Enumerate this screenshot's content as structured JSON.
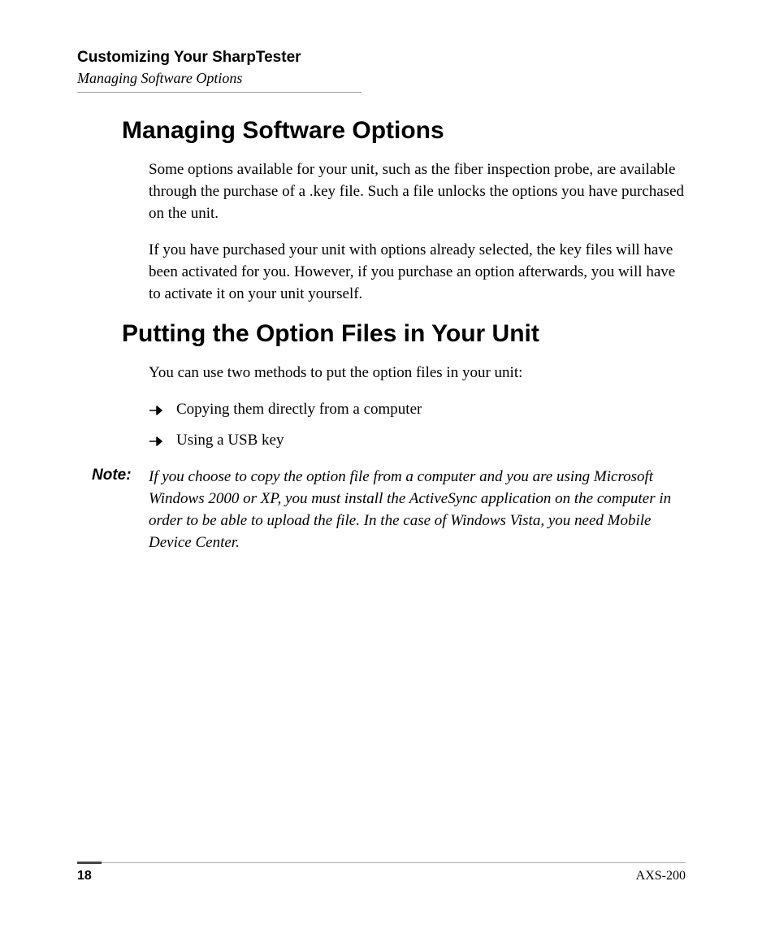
{
  "header": {
    "chapter": "Customizing Your SharpTester",
    "section": "Managing Software Options"
  },
  "sections": {
    "h1": "Managing Software Options",
    "p1": "Some options available for your unit, such as the fiber inspection probe, are available through the purchase of a .key file. Such a file unlocks the options you have purchased on the unit.",
    "p2": "If you have purchased your unit with options already selected, the key files will have been activated for you. However, if you purchase an option afterwards, you will have to activate it on your unit yourself.",
    "h2": "Putting the Option Files in Your Unit",
    "p3": "You can use two methods to put the option files in your unit:",
    "bullets": {
      "b1": "Copying them directly from a computer",
      "b2": "Using a USB key"
    },
    "note_label": "Note:",
    "note_text": "If you choose to copy the option file from a computer and you are using Microsoft Windows 2000 or XP, you must install the ActiveSync application on the computer in order to be able to upload the file. In the case of Windows Vista, you need Mobile Device Center."
  },
  "footer": {
    "page": "18",
    "model": "AXS-200"
  }
}
